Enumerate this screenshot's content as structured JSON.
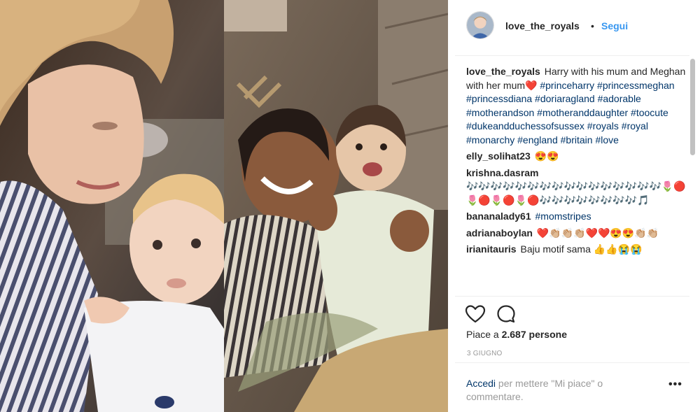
{
  "post": {
    "username": "love_the_royals",
    "separator": "•",
    "follow_label": "Segui"
  },
  "caption": {
    "username": "love_the_royals",
    "text": "Harry with his mum and Meghan with her mum❤️ ",
    "hashtags": "#princeharry #princessmeghan #princessdiana #doriaragland #adorable #motherandson #motheranddaughter #toocute #dukeandduchessofsussex #royals #royal #monarchy #england #britain #love"
  },
  "comments": [
    {
      "username": "elly_solihat23",
      "text": "😍😍"
    },
    {
      "username": "krishna.dasram",
      "text": "🎶🎶🎶🎶🎶🎶🎶🎶🎶🎶🎶🎶🎶🎶🎶🎶🌷🔴🌷🔴🌷🔴🌷🔴🎶🎶🎶🎶🎶🎶🎶🎶🎵"
    },
    {
      "username": "bananalady61",
      "text": "#momstripes"
    },
    {
      "username": "adrianaboylan",
      "text": "❤️👏🏼👏🏼👏🏼❤️❤️😍😍👏🏼👏🏼"
    },
    {
      "username": "irianitauris",
      "text": "Baju motif sama 👍👍😭😭"
    }
  ],
  "likes": {
    "label": "Piace a ",
    "count": "2.687 persone"
  },
  "date": "3 GIUGNO",
  "login": {
    "link": "Accedi",
    "text": " per mettere \"Mi piace\" o commentare."
  },
  "more_label": "•••",
  "icons": {
    "like": "heart-outline-icon",
    "comment": "speech-bubble-icon"
  },
  "colors": {
    "link_blue": "#3897f0",
    "hashtag": "#003569",
    "muted": "#999999",
    "text": "#262626"
  }
}
